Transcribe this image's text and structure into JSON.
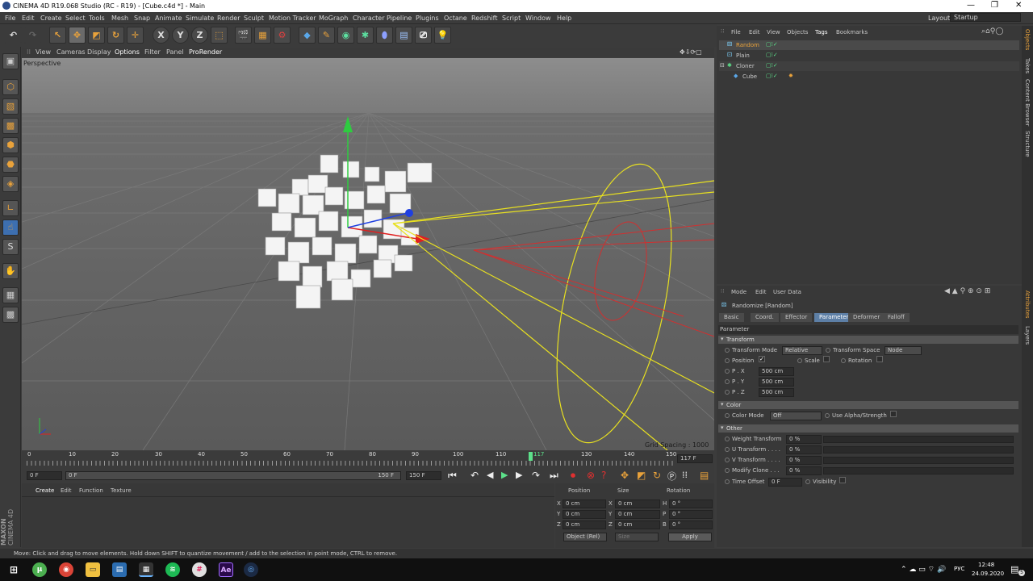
{
  "window": {
    "title": "CINEMA 4D R19.068 Studio (RC - R19) - [Cube.c4d *] - Main",
    "layout_label": "Layout:",
    "layout_value": "Startup"
  },
  "menu": [
    "File",
    "Edit",
    "Create",
    "Select",
    "Tools",
    "Mesh",
    "Snap",
    "Animate",
    "Simulate",
    "Render",
    "Sculpt",
    "Motion Tracker",
    "MoGraph",
    "Character",
    "Pipeline",
    "Plugins",
    "Octane",
    "Redshift",
    "Script",
    "Window",
    "Help"
  ],
  "toolbar": {
    "x_label": "X",
    "y_label": "Y",
    "z_label": "Z"
  },
  "viewport": {
    "menu": [
      "View",
      "Cameras",
      "Display",
      "Options",
      "Filter",
      "Panel",
      "ProRender"
    ],
    "label": "Perspective",
    "grid_spacing": "Grid Spacing : 1000 cm"
  },
  "timeline": {
    "ticks": [
      "0",
      "10",
      "20",
      "30",
      "40",
      "50",
      "60",
      "70",
      "80",
      "90",
      "100",
      "110",
      "117",
      "130",
      "140",
      "150"
    ],
    "current_frame": "117 F",
    "start": "0 F",
    "range_start": "0 F",
    "range_end": "150 F",
    "end": "150 F"
  },
  "material_menu": [
    "Create",
    "Edit",
    "Function",
    "Texture"
  ],
  "coords": {
    "headers": [
      "Position",
      "Size",
      "Rotation"
    ],
    "rows": [
      {
        "a": "X",
        "pos": "0 cm",
        "b": "X",
        "size": "0 cm",
        "c": "H",
        "rot": "0 °"
      },
      {
        "a": "Y",
        "pos": "0 cm",
        "b": "Y",
        "size": "0 cm",
        "c": "P",
        "rot": "0 °"
      },
      {
        "a": "Z",
        "pos": "0 cm",
        "b": "Z",
        "size": "0 cm",
        "c": "B",
        "rot": "0 °"
      }
    ],
    "mode": "Object (Rel)",
    "size_mode": "Size",
    "apply": "Apply"
  },
  "object_manager": {
    "menu": [
      "File",
      "Edit",
      "View",
      "Objects",
      "Tags",
      "Bookmarks"
    ],
    "objects": [
      {
        "name": "Random",
        "indent": 0,
        "selected": true
      },
      {
        "name": "Plain",
        "indent": 0,
        "selected": false
      },
      {
        "name": "Cloner",
        "indent": 0,
        "selected": false
      },
      {
        "name": "Cube",
        "indent": 1,
        "selected": false
      }
    ]
  },
  "attributes": {
    "menu": [
      "Mode",
      "Edit",
      "User Data"
    ],
    "title": "Randomize [Random]",
    "tabs": [
      "Basic",
      "Coord.",
      "Effector",
      "Parameter",
      "Deformer",
      "Falloff"
    ],
    "active_tab": "Parameter",
    "parameter_header": "Parameter",
    "transform": {
      "header": "Transform",
      "mode_label": "Transform Mode",
      "mode_value": "Relative",
      "space_label": "Transform Space",
      "space_value": "Node",
      "position_label": "Position",
      "scale_label": "Scale",
      "rotation_label": "Rotation",
      "px_label": "P . X",
      "px": "500 cm",
      "py_label": "P . Y",
      "py": "500 cm",
      "pz_label": "P . Z",
      "pz": "500 cm"
    },
    "color": {
      "header": "Color",
      "mode_label": "Color Mode",
      "mode_value": "Off",
      "alpha_label": "Use Alpha/Strength"
    },
    "other": {
      "header": "Other",
      "rows": [
        {
          "label": "Weight Transform",
          "value": "0 %"
        },
        {
          "label": "U Transform . . . .",
          "value": "0 %"
        },
        {
          "label": "V Transform . . . .",
          "value": "0 %"
        },
        {
          "label": "Modify Clone . . .",
          "value": "0 %"
        }
      ],
      "time_offset_label": "Time Offset",
      "time_offset": "0 F",
      "visibility_label": "Visibility"
    }
  },
  "right_tabs": [
    "Objects",
    "Takes",
    "Content Browser",
    "Structure",
    "Attributes",
    "Layers"
  ],
  "status": "Move: Click and drag to move elements. Hold down SHIFT to quantize movement / add to the selection in point mode, CTRL to remove.",
  "taskbar": {
    "lang": "РУС",
    "time": "12:48",
    "date": "24.09.2020",
    "notif_count": "5"
  },
  "brand": {
    "maxon": "MAXON",
    "product": "CINEMA 4D"
  }
}
